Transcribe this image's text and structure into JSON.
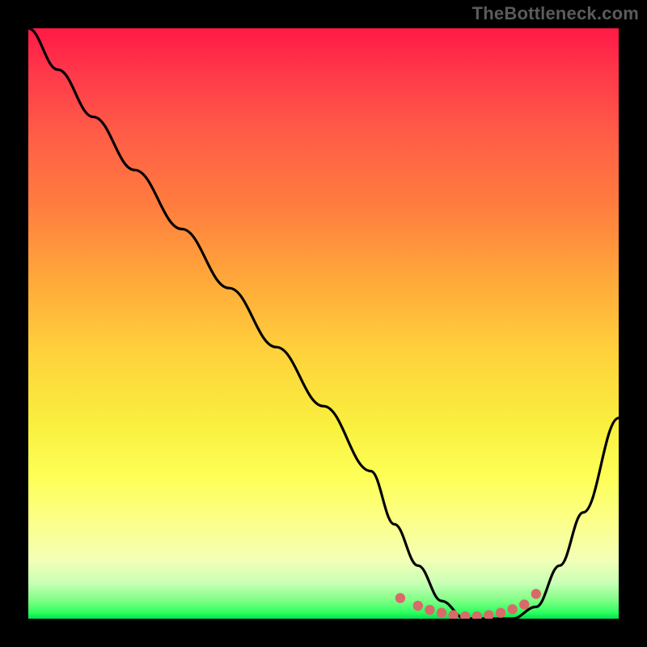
{
  "watermark": "TheBottleneck.com",
  "chart_data": {
    "type": "line",
    "title": "",
    "xlabel": "",
    "ylabel": "",
    "xlim": [
      0,
      100
    ],
    "ylim": [
      0,
      100
    ],
    "series": [
      {
        "name": "bottleneck-curve",
        "x": [
          0,
          5,
          11,
          18,
          26,
          34,
          42,
          50,
          58,
          62,
          66,
          70,
          74,
          78,
          82,
          86,
          90,
          94,
          100
        ],
        "y": [
          100,
          93,
          85,
          76,
          66,
          56,
          46,
          36,
          25,
          16,
          9,
          3,
          0,
          0,
          0,
          2,
          9,
          18,
          34
        ]
      }
    ],
    "markers": {
      "name": "optimal-region-dots",
      "x": [
        63,
        66,
        68,
        70,
        72,
        74,
        76,
        78,
        80,
        82,
        84,
        86
      ],
      "y": [
        3.5,
        2.2,
        1.5,
        1.0,
        0.6,
        0.4,
        0.4,
        0.6,
        1.0,
        1.6,
        2.4,
        4.2
      ]
    },
    "gradient_stops": [
      {
        "pos": 0,
        "color": "#ff1a46"
      },
      {
        "pos": 18,
        "color": "#ff5d47"
      },
      {
        "pos": 42,
        "color": "#ffa63a"
      },
      {
        "pos": 67,
        "color": "#f9ef3e"
      },
      {
        "pos": 90,
        "color": "#f3ffb6"
      },
      {
        "pos": 100,
        "color": "#00e04f"
      }
    ]
  }
}
